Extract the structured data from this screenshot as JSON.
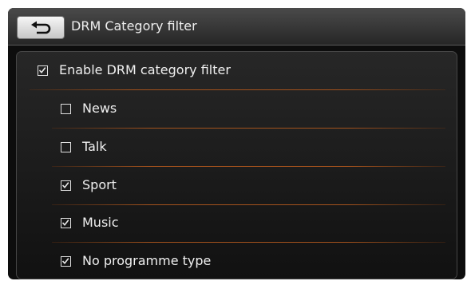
{
  "header": {
    "title": "DRM Category filter",
    "back_icon": "back-arrow-icon"
  },
  "filters": [
    {
      "label": "Enable DRM category filter",
      "checked": true
    },
    {
      "label": "News",
      "checked": false
    },
    {
      "label": "Talk",
      "checked": false
    },
    {
      "label": "Sport",
      "checked": true
    },
    {
      "label": "Music",
      "checked": true
    },
    {
      "label": "No programme type",
      "checked": true
    }
  ],
  "colors": {
    "background": "#0d0d0d",
    "divider": "#a4521c",
    "text": "#f0f0f0"
  }
}
